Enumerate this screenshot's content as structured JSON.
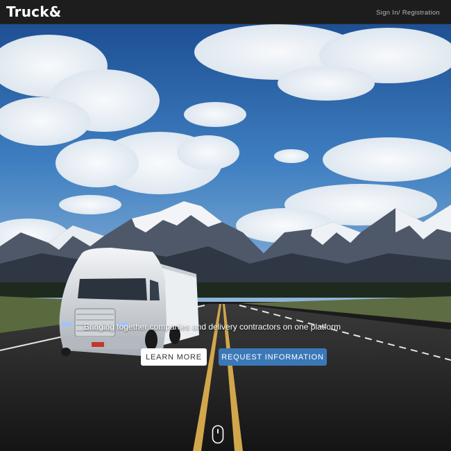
{
  "header": {
    "logo": "Truck&",
    "signin_label": "Sign In/ Registration"
  },
  "hero": {
    "tagline": "Bringing together companies and delivery contractors on one platform",
    "learn_more_label": "LEARN MORE",
    "request_info_label": "REQUEST INFORMATION"
  },
  "icons": {
    "scroll": "mouse-scroll-icon"
  },
  "colors": {
    "topbar": "#1d1d1d",
    "primary_button": "#3b78b8",
    "secondary_button": "#ffffff"
  }
}
